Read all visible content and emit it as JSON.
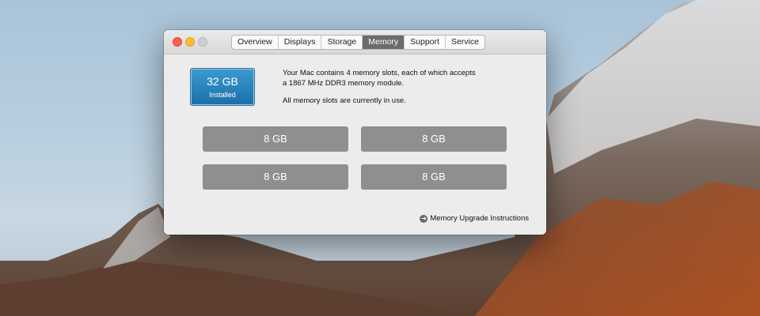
{
  "window": {
    "tabs": [
      {
        "label": "Overview",
        "active": false
      },
      {
        "label": "Displays",
        "active": false
      },
      {
        "label": "Storage",
        "active": false
      },
      {
        "label": "Memory",
        "active": true
      },
      {
        "label": "Support",
        "active": false
      },
      {
        "label": "Service",
        "active": false
      }
    ]
  },
  "memory": {
    "total": "32 GB",
    "installed_label": "Installed",
    "description_line1": "Your Mac contains 4 memory slots, each of which accepts",
    "description_line2": "a 1867 MHz DDR3 memory module.",
    "status": "All memory slots are currently in use.",
    "slots": [
      "8 GB",
      "8 GB",
      "8 GB",
      "8 GB"
    ],
    "upgrade_link": "Memory Upgrade Instructions"
  },
  "icons": {
    "upgrade": "arrow-right-circle-icon"
  },
  "colors": {
    "summary_accent": "#2581bd",
    "active_tab": "#6c6c6c",
    "slot": "#8f8f8f"
  }
}
